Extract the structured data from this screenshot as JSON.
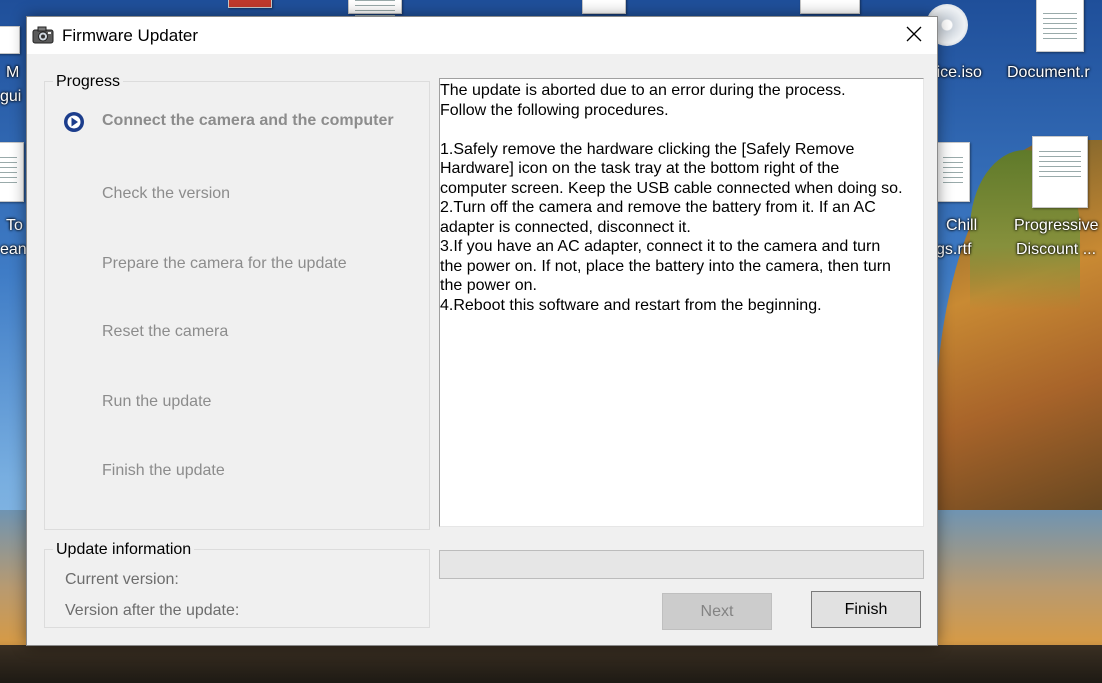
{
  "window": {
    "title": "Firmware Updater",
    "close_label": "×"
  },
  "progress": {
    "group_label": "Progress",
    "steps": [
      {
        "label": "Connect the camera and the computer",
        "state": "active"
      },
      {
        "label": "Check the version",
        "state": "pending"
      },
      {
        "label": "Prepare the camera for the update",
        "state": "pending"
      },
      {
        "label": "Reset the camera",
        "state": "pending"
      },
      {
        "label": "Run the update",
        "state": "pending"
      },
      {
        "label": "Finish the update",
        "state": "pending"
      }
    ]
  },
  "update_info": {
    "group_label": "Update information",
    "current_version_label": "Current version:",
    "version_after_label": "Version after the update:"
  },
  "message": {
    "lines": [
      "The update is aborted due to an error during the process.",
      "Follow the following procedures.",
      "",
      "1.Safely remove the hardware clicking the [Safely Remove",
      "Hardware] icon on the task tray at the bottom right of the",
      "computer screen. Keep the USB cable connected when doing so.",
      "2.Turn off  the camera and remove the battery from it. If an AC",
      "adapter is connected, disconnect it.",
      "3.If you have an AC adapter, connect it to the camera and turn",
      "the power on.  If not, place the battery into the camera, then turn",
      "the power on.",
      "4.Reboot this software and restart from the beginning."
    ]
  },
  "progress_bar": {
    "value": 0
  },
  "buttons": {
    "next_label": "Next",
    "next_enabled": false,
    "finish_label": "Finish"
  },
  "desktop_icons": [
    {
      "label": "M",
      "name": "desktop-icon-left-top"
    },
    {
      "label": "gui",
      "name": "desktop-icon-left-top-line2"
    },
    {
      "label": "To",
      "name": "desktop-icon-left-mid"
    },
    {
      "label": "ean",
      "name": "desktop-icon-left-mid-line2"
    },
    {
      "label": "ffice.iso",
      "name": "desktop-icon-office-iso"
    },
    {
      "label": "Document.r",
      "name": "desktop-icon-document"
    },
    {
      "label": "Chill",
      "name": "desktop-icon-chill"
    },
    {
      "label": "gs.rtf",
      "name": "desktop-icon-chill-line2"
    },
    {
      "label": "Progressive",
      "name": "desktop-icon-progressive"
    },
    {
      "label": "Discount ...",
      "name": "desktop-icon-progressive-line2"
    }
  ],
  "colors": {
    "window_bg": "#f0f0f0",
    "active_marker": "#1c3d8c",
    "disabled_text": "#8c8c8c"
  }
}
